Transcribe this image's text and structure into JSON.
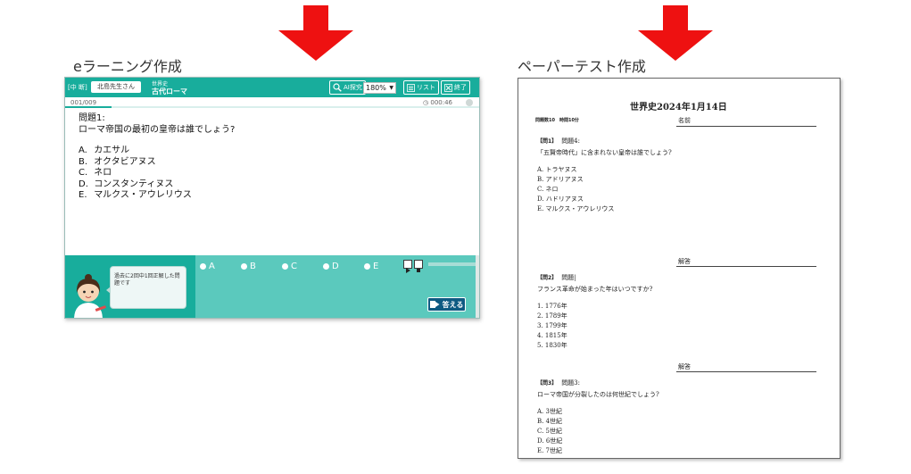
{
  "headings": {
    "elearning": "eラーニング作成",
    "paper": "ペーパーテスト作成"
  },
  "colors": {
    "arrow": "#ee1111",
    "teal": "#18ad9c",
    "teal_light": "#5bc9bd",
    "answer_button": "#0e5a82"
  },
  "elearning": {
    "mode_label": "[中 断]",
    "user_name": "北島先生さん",
    "subject": "世界史",
    "topic": "古代ローマ",
    "ai_button": "AI探究",
    "ai_icon": "magnifier-icon",
    "zoom": "180%",
    "list_button": "リスト",
    "list_icon": "list-icon",
    "end_button": "終了",
    "end_icon": "close-box-icon",
    "counter": "001/009",
    "progress": 0.111,
    "timer": "000:46",
    "timer_icon": "clock-icon",
    "question_number": "問題1:",
    "question_text": "ローマ帝国の最初の皇帝は誰でしょう?",
    "choices": [
      {
        "letter": "A.",
        "text": "カエサル"
      },
      {
        "letter": "B.",
        "text": "オクタビアヌス"
      },
      {
        "letter": "C.",
        "text": "ネロ"
      },
      {
        "letter": "D.",
        "text": "コンスタンティヌス"
      },
      {
        "letter": "E.",
        "text": "マルクス・アウレリウス"
      }
    ],
    "hint_bubble": "過去に2回中1回正解した問題です",
    "answer_options": [
      "A",
      "B",
      "C",
      "D",
      "E"
    ],
    "answer_button": "答える",
    "answer_icon": "enter-arrow-icon"
  },
  "paper": {
    "title": "世界史2024年1月14日",
    "meta": "問題数10　時間10分",
    "name_label": "名前",
    "answer_label": "解答",
    "questions": [
      {
        "tag": "【問1】",
        "label": "問題4:",
        "text": "「五賢帝時代」に含まれない皇帝は誰でしょう?",
        "choices": [
          "A. トラヤヌス",
          "B. アドリアヌス",
          "C. ネロ",
          "D. ハドリアヌス",
          "E. マルクス・アウレリウス"
        ]
      },
      {
        "tag": "【問2】",
        "label": "問題|",
        "text": "フランス革命が始まった年はいつですか?",
        "choices": [
          "1. 1776年",
          "2. 1789年",
          "3. 1799年",
          "4. 1815年",
          "5. 1830年"
        ]
      },
      {
        "tag": "【問3】",
        "label": "問題3:",
        "text": "ローマ帝国が分裂したのは何世紀でしょう?",
        "choices": [
          "A. 3世紀",
          "B. 4世紀",
          "C. 5世紀",
          "D. 6世紀",
          "E. 7世紀"
        ]
      }
    ]
  }
}
